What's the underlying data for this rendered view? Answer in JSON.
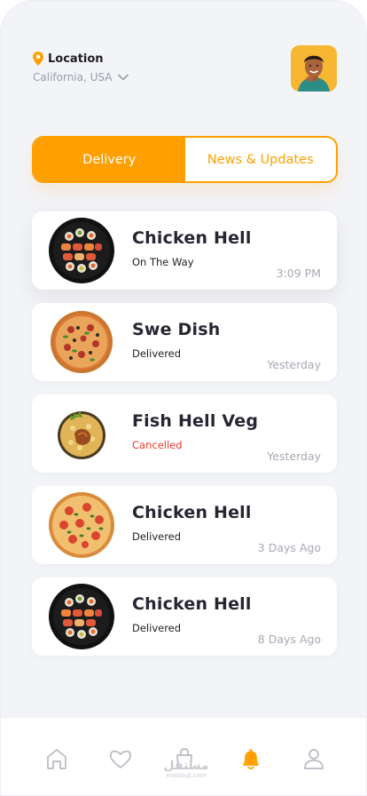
{
  "header": {
    "location_label": "Location",
    "location_value": "California, USA"
  },
  "tabs": [
    {
      "label": "Delivery",
      "active": true
    },
    {
      "label": "News & Updates",
      "active": false
    }
  ],
  "orders": [
    {
      "name": "Chicken Hell",
      "status": "On The Way",
      "time": "3:09 PM",
      "food": "sushi-platter"
    },
    {
      "name": "Swe Dish",
      "status": "Delivered",
      "time": "Yesterday",
      "food": "pizza"
    },
    {
      "name": "Fish Hell Veg",
      "status": "Cancelled",
      "time": "Yesterday",
      "food": "biryani"
    },
    {
      "name": "Chicken Hell",
      "status": "Delivered",
      "time": "3 Days Ago",
      "food": "pizza"
    },
    {
      "name": "Chicken Hell",
      "status": "Delivered",
      "time": "8 Days Ago",
      "food": "sushi-platter"
    }
  ],
  "nav": {
    "items": [
      "home-icon",
      "heart-icon",
      "bag-icon",
      "bell-icon",
      "profile-icon"
    ],
    "active": "bell-icon"
  },
  "watermark": {
    "text": "مستقل",
    "sub": "mostaql.com"
  },
  "colors": {
    "accent": "#ffa000",
    "cancelled": "#ea3b2e",
    "background": "#f3f4f8"
  }
}
